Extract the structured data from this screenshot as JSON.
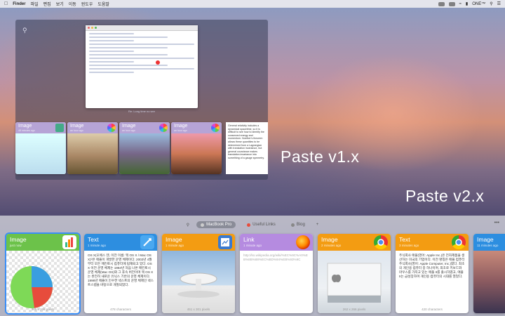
{
  "menubar": {
    "apple": "",
    "app": "Finder",
    "items": [
      "파일",
      "편집",
      "보기",
      "이동",
      "윈도우",
      "도움말"
    ],
    "right_label": "ONE™"
  },
  "v1": {
    "mail_caption": "Re: Long time no see",
    "cards": [
      {
        "type": "Image",
        "sub": "48 minutes ago"
      },
      {
        "type": "Image",
        "sub": "an hour ago"
      },
      {
        "type": "Image",
        "sub": "an hour ago"
      },
      {
        "type": "Image",
        "sub": "an hour ago"
      }
    ],
    "text_card": "General relativity includes a dynamical spacetime, so it is difficult to see how to identify the conserved energy and momentum. Noether's theorem allows these quantities to be determined from a Lagrangian with translation invariance, but general covariance makes translation invariance into something of a gauge symmetry."
  },
  "labels": {
    "v1": "Paste v1.x",
    "v2": "Paste v2.x"
  },
  "tray": {
    "tabs": [
      {
        "label": "MacBook Pro",
        "color": "#8a8c98",
        "active": true
      },
      {
        "label": "Useful Links",
        "color": "#e74c3c",
        "active": false
      },
      {
        "label": "Blog",
        "color": "#888888",
        "active": false
      }
    ],
    "add": "+",
    "more": "•••",
    "search_icon": "search-icon",
    "cards": [
      {
        "kind": "Image",
        "sub": "just now",
        "color": "#6cc24a",
        "foot": "345 x 266 pixels"
      },
      {
        "kind": "Text",
        "sub": "1 minute ago",
        "color": "#2d8ee0",
        "body": "OS X(오에스 텐, 이전 이름: 맥 OS X / Mac OS X)⁰은 애플이 개발한 운영 체제이다. 2002년 4월부터 모든 매킨토시 컴퓨터에 탑재되고 있다. OS X 이전 운영 체제는 1984년 처음 나온 매킨토시 운영 체제(Mac OS)와 그 후속 버전이며 맥 OS X는 완전히 새로운 유닉스 기반의 운영 체제이다. 1996년 애플이 인수한 넥스트의 운영 체제인 넥스트스텝을 바탕으로 개발되었다.",
        "foot": "478 characters"
      },
      {
        "kind": "Image",
        "sub": "1 minute ago",
        "color": "#f39c12",
        "foot": "451 x 301 pixels"
      },
      {
        "kind": "Link",
        "sub": "1 minute ago",
        "color": "#b58be0",
        "body": "http://ko.wikipedia.org/wiki/%EC%9C%A0%EB%8B%88%EC%BD%94%EB%93%9C",
        "foot": ""
      },
      {
        "kind": "Image",
        "sub": "2 minutes ago",
        "color": "#f39c12",
        "foot": "262 x 266 pixels"
      },
      {
        "kind": "Text",
        "sub": "3 minutes ago",
        "color": "#f39c12",
        "body": "주식회사 애플(영어: Apple Inc.)은 전자제품을 생산하는 미국의 기업이다. 이전 명칭은 애플 컴퓨터 주식회사(영어: Apple Computer, Inc.)였다. 최초의 개인용 컴퓨터 중 하나이며, 최초로 키보드와 마우스를 가지고 있는 애플 II를 출시하였고, 애플 II는 급성장하며 개인용 컴퓨터의 시대를 열었다.",
        "foot": "420 characters"
      },
      {
        "kind": "Image",
        "sub": "11 minutes ago",
        "color": "#2d8ee0",
        "foot": ""
      }
    ]
  }
}
